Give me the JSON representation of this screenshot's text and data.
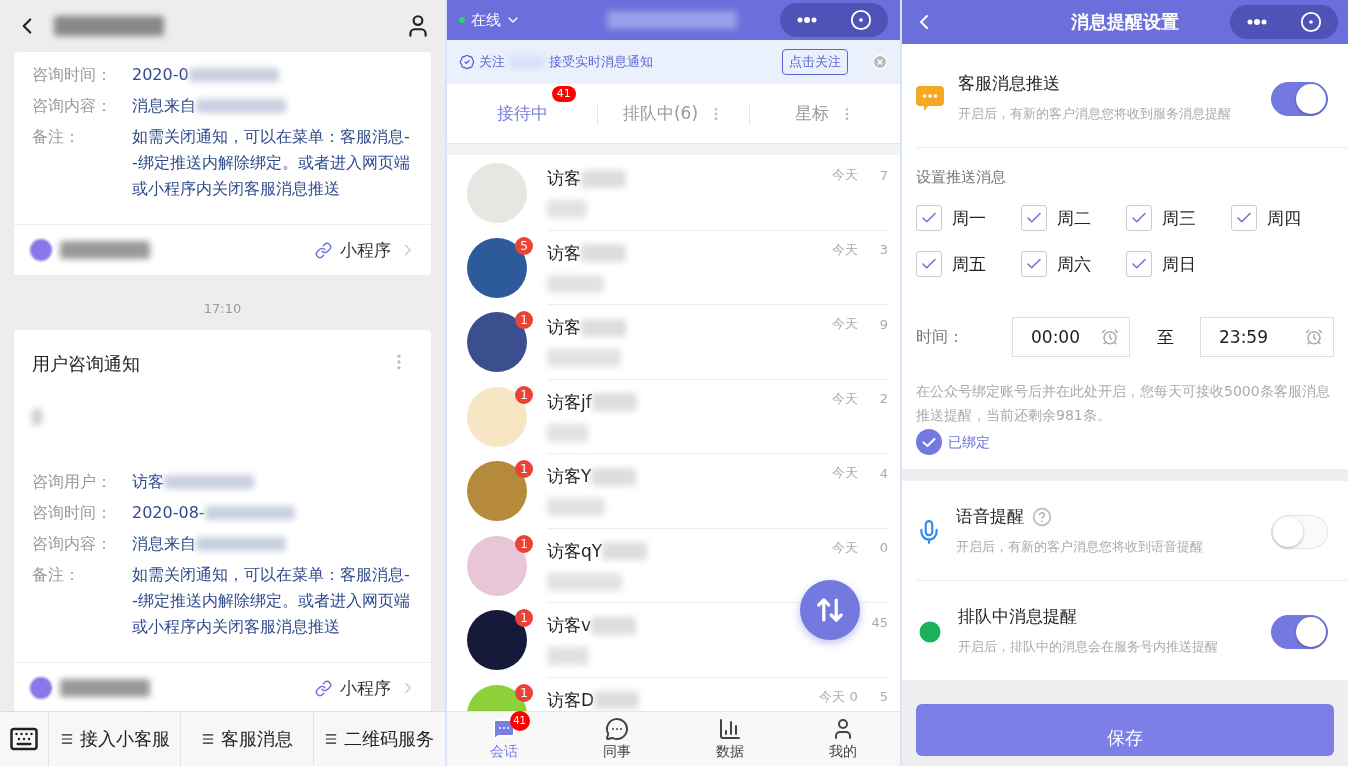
{
  "notifications_panel": {
    "feed": [
      {
        "kind": "card",
        "fields": [
          {
            "label": "咨询时间：",
            "value": "2020-0",
            "masked": true
          },
          {
            "label": "咨询内容：",
            "value": "消息来自",
            "masked": true
          },
          {
            "label": "备注：",
            "value": "如需关闭通知，可以在菜单：客服消息--绑定推送内解除绑定。或者进入网页端或小程序内关闭客服消息推送",
            "masked": false
          }
        ],
        "source_link": "小程序"
      },
      {
        "kind": "time",
        "text": "17:10"
      },
      {
        "kind": "card",
        "title": "用户咨询通知",
        "fields": [
          {
            "label": "咨询用户：",
            "value": "访客",
            "masked": true
          },
          {
            "label": "咨询时间：",
            "value": "2020-08-",
            "masked": true
          },
          {
            "label": "咨询内容：",
            "value": "消息来自",
            "masked": true
          },
          {
            "label": "备注：",
            "value": "如需关闭通知，可以在菜单：客服消息--绑定推送内解除绑定。或者进入网页端或小程序内关闭客服消息推送",
            "masked": false
          }
        ],
        "source_link": "小程序"
      }
    ],
    "menu": [
      "接入小客服",
      "客服消息",
      "二维码服务"
    ]
  },
  "chat_list_panel": {
    "status": "在线",
    "banner": {
      "lead": "关注",
      "text": "接受实时消息通知",
      "button": "点击关注"
    },
    "tabs": [
      {
        "label": "接待中",
        "badge": "41",
        "selected": true
      },
      {
        "label": "排队中(6)",
        "selected": false
      },
      {
        "label": "星标",
        "selected": false
      }
    ],
    "conversations": [
      {
        "name": "访客",
        "time_start": "今天",
        "time_end": "7"
      },
      {
        "name": "访客",
        "badge": "5",
        "time_start": "今天",
        "time_end": "3"
      },
      {
        "name": "访客",
        "badge": "1",
        "time_start": "今天",
        "time_end": "9"
      },
      {
        "name": "访客jf",
        "badge": "1",
        "time_start": "今天",
        "time_end": "2"
      },
      {
        "name": "访客Y",
        "badge": "1",
        "time_start": "今天",
        "time_end": "4"
      },
      {
        "name": "访客qY",
        "badge": "1",
        "time_start": "今天",
        "time_end": "0"
      },
      {
        "name": "访客v",
        "badge": "1",
        "time_end": "45"
      },
      {
        "name": "访客D",
        "badge": "1",
        "time_start": "今天 0",
        "time_end": "5"
      }
    ],
    "nav": [
      {
        "kind": "chats",
        "label": "会话",
        "badge": "41",
        "selected": true
      },
      {
        "kind": "colleagues",
        "label": "同事",
        "selected": false
      },
      {
        "kind": "data",
        "label": "数据",
        "selected": false
      },
      {
        "kind": "me",
        "label": "我的",
        "selected": false
      }
    ]
  },
  "settings_panel": {
    "title": "消息提醒设置",
    "push": {
      "title": "客服消息推送",
      "description": "开启后，有新的客户消息您将收到服务消息提醒",
      "on": true
    },
    "schedule_label": "设置推送消息",
    "days": [
      {
        "label": "周一",
        "checked": true
      },
      {
        "label": "周二",
        "checked": true
      },
      {
        "label": "周三",
        "checked": true
      },
      {
        "label": "周四",
        "checked": true
      },
      {
        "label": "周五",
        "checked": true
      },
      {
        "label": "周六",
        "checked": true
      },
      {
        "label": "周日",
        "checked": true
      }
    ],
    "time": {
      "label": "时间：",
      "start": "00:00",
      "separator": "至",
      "end": "23:59"
    },
    "quota_note": "在公众号绑定账号后并在此处开启，您每天可接收5000条客服消息推送提醒，当前还剩余981条。",
    "bound_status": "已绑定",
    "alerts": [
      {
        "kind": "voice",
        "title": "语音提醒",
        "help": true,
        "description": "开启后，有新的客户消息您将收到语音提醒",
        "on": false
      },
      {
        "kind": "queue",
        "title": "排队中消息提醒",
        "description": "开启后，排队中的消息会在服务号内推送提醒",
        "on": true
      }
    ],
    "save_button": "保存"
  }
}
